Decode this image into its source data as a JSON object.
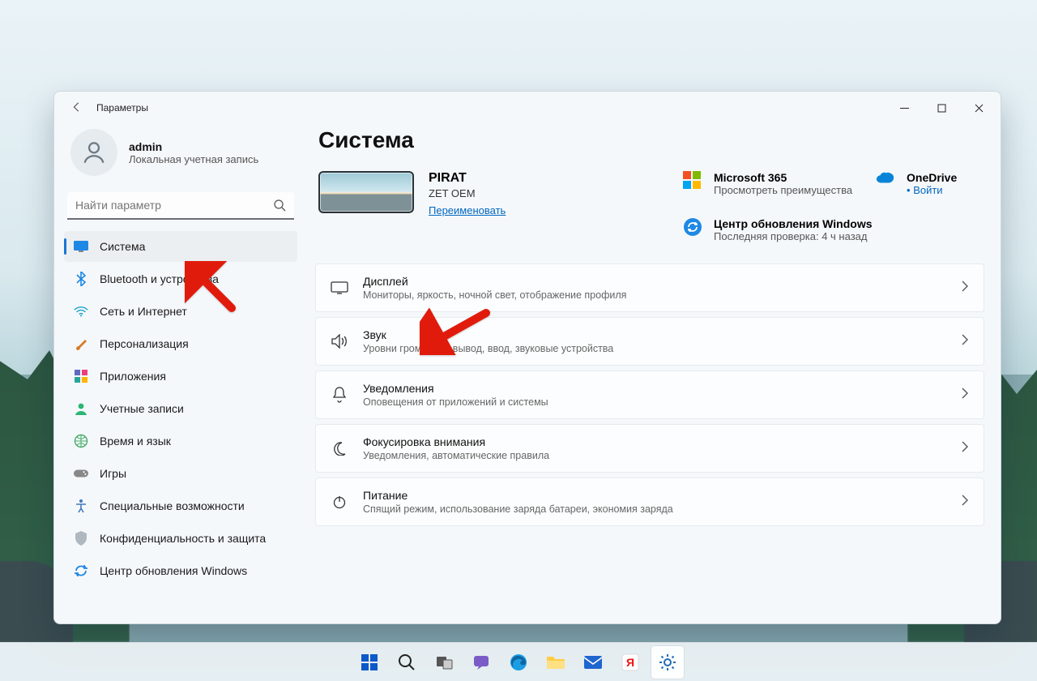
{
  "window": {
    "title": "Параметры"
  },
  "profile": {
    "name": "admin",
    "subtitle": "Локальная учетная запись"
  },
  "search": {
    "placeholder": "Найти параметр"
  },
  "sidebar": {
    "items": [
      {
        "id": "system",
        "label": "Система"
      },
      {
        "id": "bluetooth",
        "label": "Bluetooth и устройства"
      },
      {
        "id": "network",
        "label": "Сеть и Интернет"
      },
      {
        "id": "personalization",
        "label": "Персонализация"
      },
      {
        "id": "apps",
        "label": "Приложения"
      },
      {
        "id": "accounts",
        "label": "Учетные записи"
      },
      {
        "id": "time",
        "label": "Время и язык"
      },
      {
        "id": "gaming",
        "label": "Игры"
      },
      {
        "id": "accessibility",
        "label": "Специальные возможности"
      },
      {
        "id": "privacy",
        "label": "Конфиденциальность и защита"
      },
      {
        "id": "update",
        "label": "Центр обновления Windows"
      }
    ]
  },
  "page": {
    "title": "Система"
  },
  "pc": {
    "name": "PIRAT",
    "oem": "ZET OEM",
    "rename": "Переименовать"
  },
  "promos": {
    "m365": {
      "title": "Microsoft 365",
      "subtitle": "Просмотреть преимущества"
    },
    "onedrive": {
      "title": "OneDrive",
      "subtitle": "Войти"
    },
    "update": {
      "title": "Центр обновления Windows",
      "subtitle": "Последняя проверка: 4 ч назад"
    }
  },
  "cards": [
    {
      "id": "display",
      "title": "Дисплей",
      "subtitle": "Мониторы, яркость, ночной свет, отображение профиля"
    },
    {
      "id": "sound",
      "title": "Звук",
      "subtitle": "Уровни громкости, вывод, ввод, звуковые устройства"
    },
    {
      "id": "notif",
      "title": "Уведомления",
      "subtitle": "Оповещения от приложений и системы"
    },
    {
      "id": "focus",
      "title": "Фокусировка внимания",
      "subtitle": "Уведомления, автоматические правила"
    },
    {
      "id": "power",
      "title": "Питание",
      "subtitle": "Спящий режим, использование заряда батареи, экономия заряда"
    }
  ],
  "colors": {
    "accent": "#1976d2",
    "arrow": "#e11b0c"
  }
}
